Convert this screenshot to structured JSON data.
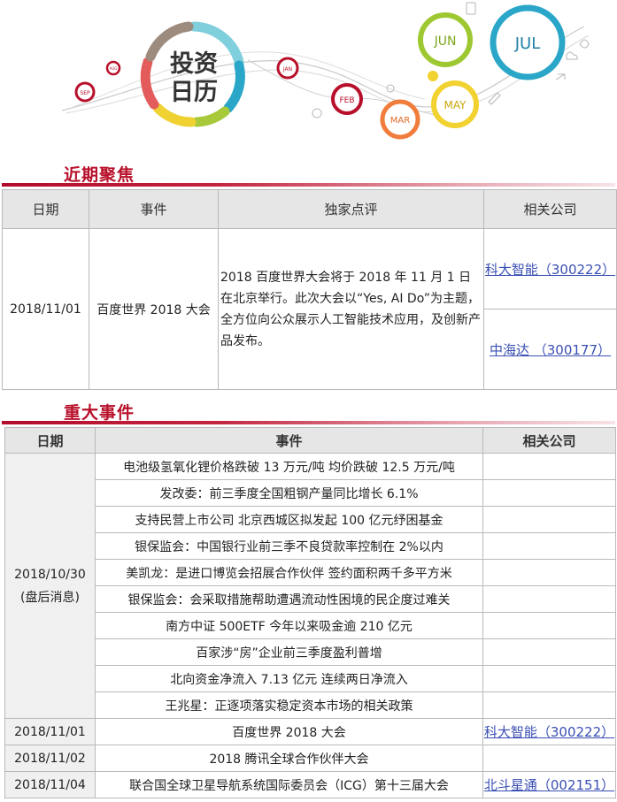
{
  "banner": {
    "logo_line1": "投资",
    "logo_line2": "日历",
    "months": {
      "sep": "SEP",
      "aug": "AUG",
      "jan": "JAN",
      "feb": "FEB",
      "mar": "MAR",
      "may": "MAY",
      "jun": "JUN",
      "jul": "JUL"
    }
  },
  "focus": {
    "title": "近期聚焦",
    "headers": [
      "日期",
      "事件",
      "独家点评",
      "相关公司"
    ],
    "date": "2018/11/01",
    "event": "百度世界 2018 大会",
    "comment": "2018 百度世界大会将于 2018 年 11 月 1 日在北京举行。此次大会以“Yes, AI Do”为主题，全方位向公众展示人工智能技术应用，及创新产品发布。",
    "companies": [
      "科大智能（300222）",
      "中海达 （300177）"
    ]
  },
  "events": {
    "title": "重大事件",
    "headers": [
      "日期",
      "事件",
      "相关公司"
    ],
    "group_date": "2018/10/30",
    "group_note": "(盘后消息)",
    "group_items": [
      "电池级氢氧化锂价格跌破 13 万元/吨 均价跌破 12.5 万元/吨",
      "发改委：前三季度全国粗钢产量同比增长 6.1%",
      "支持民营上市公司 北京西城区拟发起 100 亿元纾困基金",
      "银保监会：中国银行业前三季不良贷款率控制在 2%以内",
      "美凯龙：是进口博览会招展合作伙伴 签约面积两千多平方米",
      "银保监会：会采取措施帮助遭遇流动性困境的民企度过难关",
      "南方中证 500ETF 今年以来吸金逾 210 亿元",
      "百家涉“房”企业前三季度盈利普增",
      "北向资金净流入 7.13 亿元 连续两日净流入",
      "王兆星：正逐项落实稳定资本市场的相关政策"
    ],
    "rows": [
      {
        "date": "2018/11/01",
        "event": "百度世界 2018 大会",
        "company": "科大智能（300222）"
      },
      {
        "date": "2018/11/02",
        "event": "2018 腾讯全球合作伙伴大会",
        "company": ""
      },
      {
        "date": "2018/11/04",
        "event": "联合国全球卫星导航系统国际委员会（ICG）第十三届大会",
        "company": "北斗星通（002151）"
      }
    ]
  }
}
